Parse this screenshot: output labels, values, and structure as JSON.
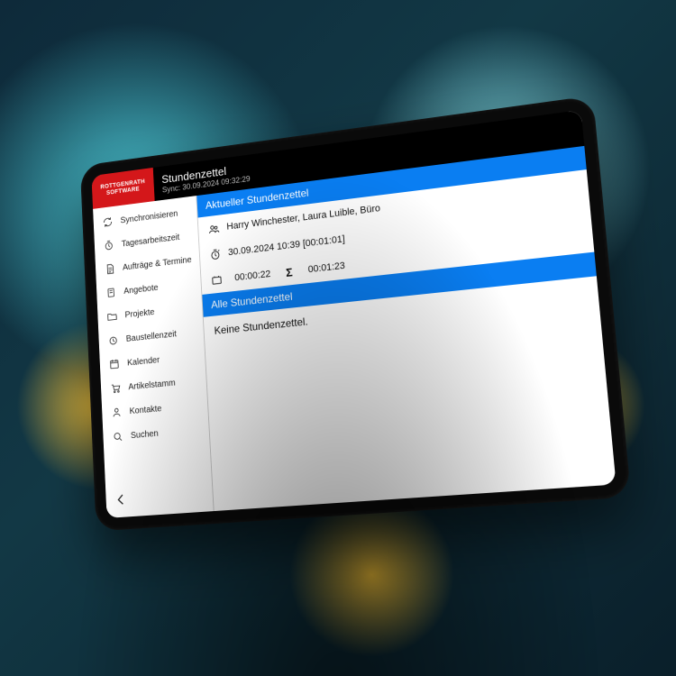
{
  "header": {
    "logo_line1": "ROTTGENRATH",
    "logo_line2": "SOFTWARE",
    "title": "Stundenzettel",
    "sync_label": "Sync: 30.09.2024 09:32:29"
  },
  "sidebar": {
    "items": [
      {
        "icon": "sync-icon",
        "label": "Synchronisieren"
      },
      {
        "icon": "timer-icon",
        "label": "Tagesarbeitszeit"
      },
      {
        "icon": "document-icon",
        "label": "Aufträge & Termine"
      },
      {
        "icon": "offer-icon",
        "label": "Angebote"
      },
      {
        "icon": "folder-icon",
        "label": "Projekte"
      },
      {
        "icon": "site-icon",
        "label": "Baustellenzeit"
      },
      {
        "icon": "calendar-icon",
        "label": "Kalender"
      },
      {
        "icon": "cart-icon",
        "label": "Artikelstamm"
      },
      {
        "icon": "person-icon",
        "label": "Kontakte"
      },
      {
        "icon": "search-icon",
        "label": "Suchen"
      }
    ]
  },
  "content": {
    "current_section": "Aktueller Stundenzettel",
    "people_line": "Harry Winchester, Laura Luible, Büro",
    "start_line": "30.09.2024 10:39 [00:01:01]",
    "totals": {
      "elapsed": "00:00:22",
      "sum": "00:01:23"
    },
    "all_section": "Alle Stundenzettel",
    "empty_text": "Keine Stundenzettel."
  }
}
